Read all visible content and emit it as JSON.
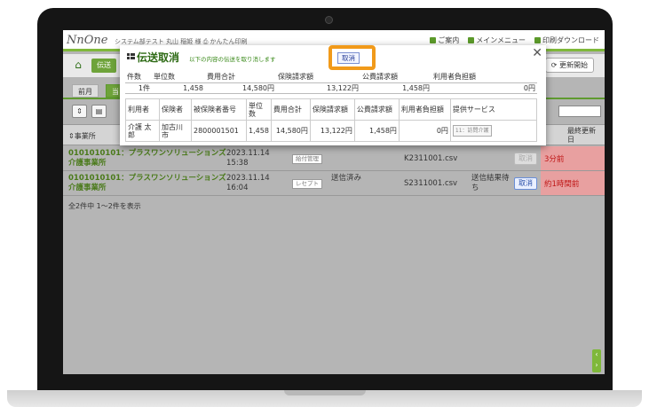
{
  "header": {
    "logo": "NnOne",
    "system_name": "システム部テスト 丸山 稲姫 様",
    "nav": [
      "かんたん印刷"
    ],
    "right_nav": [
      "ご案内",
      "メインメニュー",
      "印刷ダウンロード"
    ]
  },
  "subbar": {
    "tab_label": "伝送",
    "update_button": "更新開始"
  },
  "months": {
    "prev": "前月",
    "current": "当"
  },
  "grid": {
    "office_header": "事業所",
    "last_update_header": "最終更新日",
    "rows": [
      {
        "office": "0101010101：プラスワンソリューションズ介護事業所",
        "date": "2023.11.14 15:38",
        "status": "給付管理",
        "sent": "",
        "file": "K2311001.csv",
        "result": "",
        "cancel": "取消",
        "elapsed": "3分前"
      },
      {
        "office": "0101010101：プラスワンソリューションズ介護事業所",
        "date": "2023.11.14 16:04",
        "status": "レセプト",
        "sent": "送信済み",
        "file": "S2311001.csv",
        "result": "送信結果待ち",
        "cancel": "取消",
        "elapsed": "約1時間前"
      }
    ],
    "summary": "全2件中 1〜2件を表示"
  },
  "modal": {
    "title": "伝送取消",
    "description": "以下の内容の伝送を取り消します",
    "cancel_button": "取消",
    "summary_headers": [
      "件数",
      "単位数",
      "費用合計",
      "保険請求額",
      "公費請求額",
      "利用者負担額"
    ],
    "summary_values": [
      "1件",
      "1,458",
      "14,580円",
      "13,122円",
      "1,458円",
      "0円"
    ],
    "detail_headers": [
      "利用者",
      "保険者",
      "被保険者番号",
      "単位数",
      "費用合計",
      "保険請求額",
      "公費請求額",
      "利用者負担額",
      "提供サービス"
    ],
    "detail_values": [
      "介護 太郎",
      "加古川市",
      "2800001501",
      "1,458",
      "14,580円",
      "13,122円",
      "1,458円",
      "0円",
      "11：訪問介護"
    ]
  },
  "colors": {
    "accent_green": "#5c9a2a",
    "highlight_orange": "#f19a1a",
    "alert_red": "#c01818"
  }
}
